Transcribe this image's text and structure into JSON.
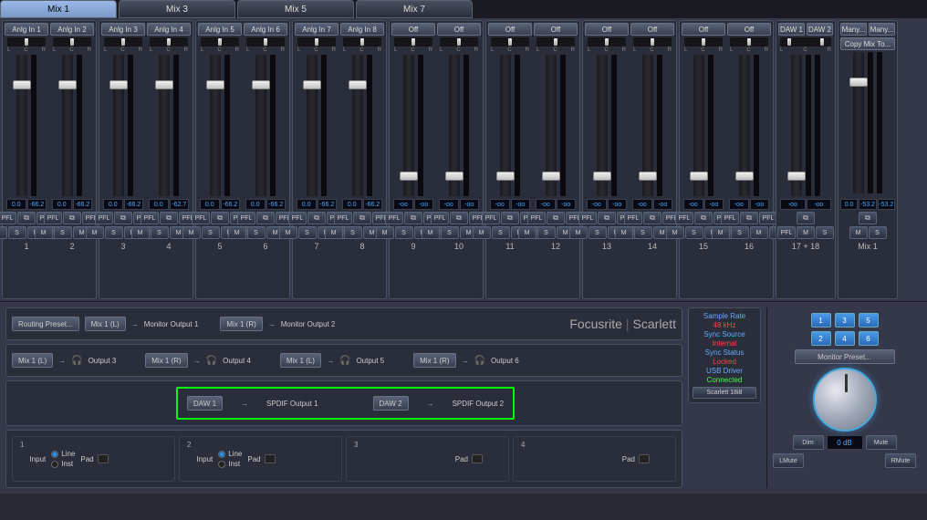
{
  "tabs": [
    "Mix 1",
    "Mix 3",
    "Mix 5",
    "Mix 7"
  ],
  "activeTab": 0,
  "channels": [
    {
      "label": "Anlg In 1",
      "v1": "0.0",
      "v2": "-66.2",
      "fader": 28
    },
    {
      "label": "Anlg In 2",
      "v1": "0.0",
      "v2": "-66.2",
      "fader": 28
    },
    {
      "label": "Anlg In 3",
      "v1": "0.0",
      "v2": "-66.2",
      "fader": 28
    },
    {
      "label": "Anlg In 4",
      "v1": "0.0",
      "v2": "-62.7",
      "fader": 28
    },
    {
      "label": "Anlg In 5",
      "v1": "0.0",
      "v2": "-66.2",
      "fader": 28
    },
    {
      "label": "Anlg In 6",
      "v1": "0.0",
      "v2": "-66.2",
      "fader": 28
    },
    {
      "label": "Anlg In 7",
      "v1": "0.0",
      "v2": "-66.2",
      "fader": 28
    },
    {
      "label": "Anlg In 8",
      "v1": "0.0",
      "v2": "-66.2",
      "fader": 28
    },
    {
      "label": "Off",
      "v1": "-oo",
      "v2": "-oo",
      "fader": 128
    },
    {
      "label": "Off",
      "v1": "-oo",
      "v2": "-oo",
      "fader": 128
    },
    {
      "label": "Off",
      "v1": "-oo",
      "v2": "-oo",
      "fader": 128
    },
    {
      "label": "Off",
      "v1": "-oo",
      "v2": "-oo",
      "fader": 128
    },
    {
      "label": "Off",
      "v1": "-oo",
      "v2": "-oo",
      "fader": 128
    },
    {
      "label": "Off",
      "v1": "-oo",
      "v2": "-oo",
      "fader": 128
    },
    {
      "label": "Off",
      "v1": "-oo",
      "v2": "-oo",
      "fader": 128
    },
    {
      "label": "Off",
      "v1": "-oo",
      "v2": "-oo",
      "fader": 128
    }
  ],
  "dawPair": {
    "l": "DAW 1",
    "r": "DAW 2",
    "lv": "-oo",
    "rv": "-oo",
    "num": "17 + 18"
  },
  "mixMaster": {
    "l": "Many...",
    "r": "Many...",
    "lv": "0.0",
    "rv1": "-53.2",
    "rv2": "-53.2",
    "num": "Mix 1",
    "copyTo": "Copy Mix To..."
  },
  "btns": {
    "pfl": "PFL",
    "m": "M",
    "s": "S"
  },
  "routing": {
    "preset": "Routing Preset...",
    "row1": [
      {
        "btn": "Mix 1 (L)",
        "lbl": "Monitor Output 1"
      },
      {
        "btn": "Mix 1 (R)",
        "lbl": "Monitor Output 2"
      }
    ],
    "row2": [
      {
        "btn": "Mix 1 (L)",
        "lbl": "Output 3",
        "hp": true
      },
      {
        "btn": "Mix 1 (R)",
        "lbl": "Output 4",
        "hp": true
      },
      {
        "btn": "Mix 1 (L)",
        "lbl": "Output 5",
        "hp": true
      },
      {
        "btn": "Mix 1 (R)",
        "lbl": "Output 6",
        "hp": true
      }
    ],
    "spdif": [
      {
        "btn": "DAW 1",
        "lbl": "SPDIF Output 1"
      },
      {
        "btn": "DAW 2",
        "lbl": "SPDIF Output 2"
      }
    ]
  },
  "brand": {
    "a": "Focusrite",
    "b": "Scarlett"
  },
  "status": {
    "items": [
      {
        "lbl": "Sample Rate",
        "val": "48 kHz",
        "cls": "red"
      },
      {
        "lbl": "Sync Source",
        "val": "Internal",
        "cls": "red"
      },
      {
        "lbl": "Sync Status",
        "val": "Locked",
        "cls": "red"
      },
      {
        "lbl": "USB  Driver",
        "val": "Connected",
        "cls": "green"
      }
    ],
    "device": "Scarlett 18i8"
  },
  "monitor": {
    "nums": [
      "1",
      "3",
      "5",
      "2",
      "4",
      "6"
    ],
    "preset": "Monitor Preset...",
    "dim": "Dim",
    "db": "0 dB",
    "mute": "Mute",
    "lmute": "LMute",
    "rmute": "RMute"
  },
  "inputs": [
    {
      "n": "1",
      "input": "Input",
      "line": "Line",
      "inst": "Inst",
      "pad": "Pad",
      "sel": 0,
      "show": true
    },
    {
      "n": "2",
      "input": "Input",
      "line": "Line",
      "inst": "Inst",
      "pad": "Pad",
      "sel": 0,
      "show": true
    },
    {
      "n": "3",
      "pad": "Pad",
      "show": false
    },
    {
      "n": "4",
      "pad": "Pad",
      "show": false
    }
  ]
}
